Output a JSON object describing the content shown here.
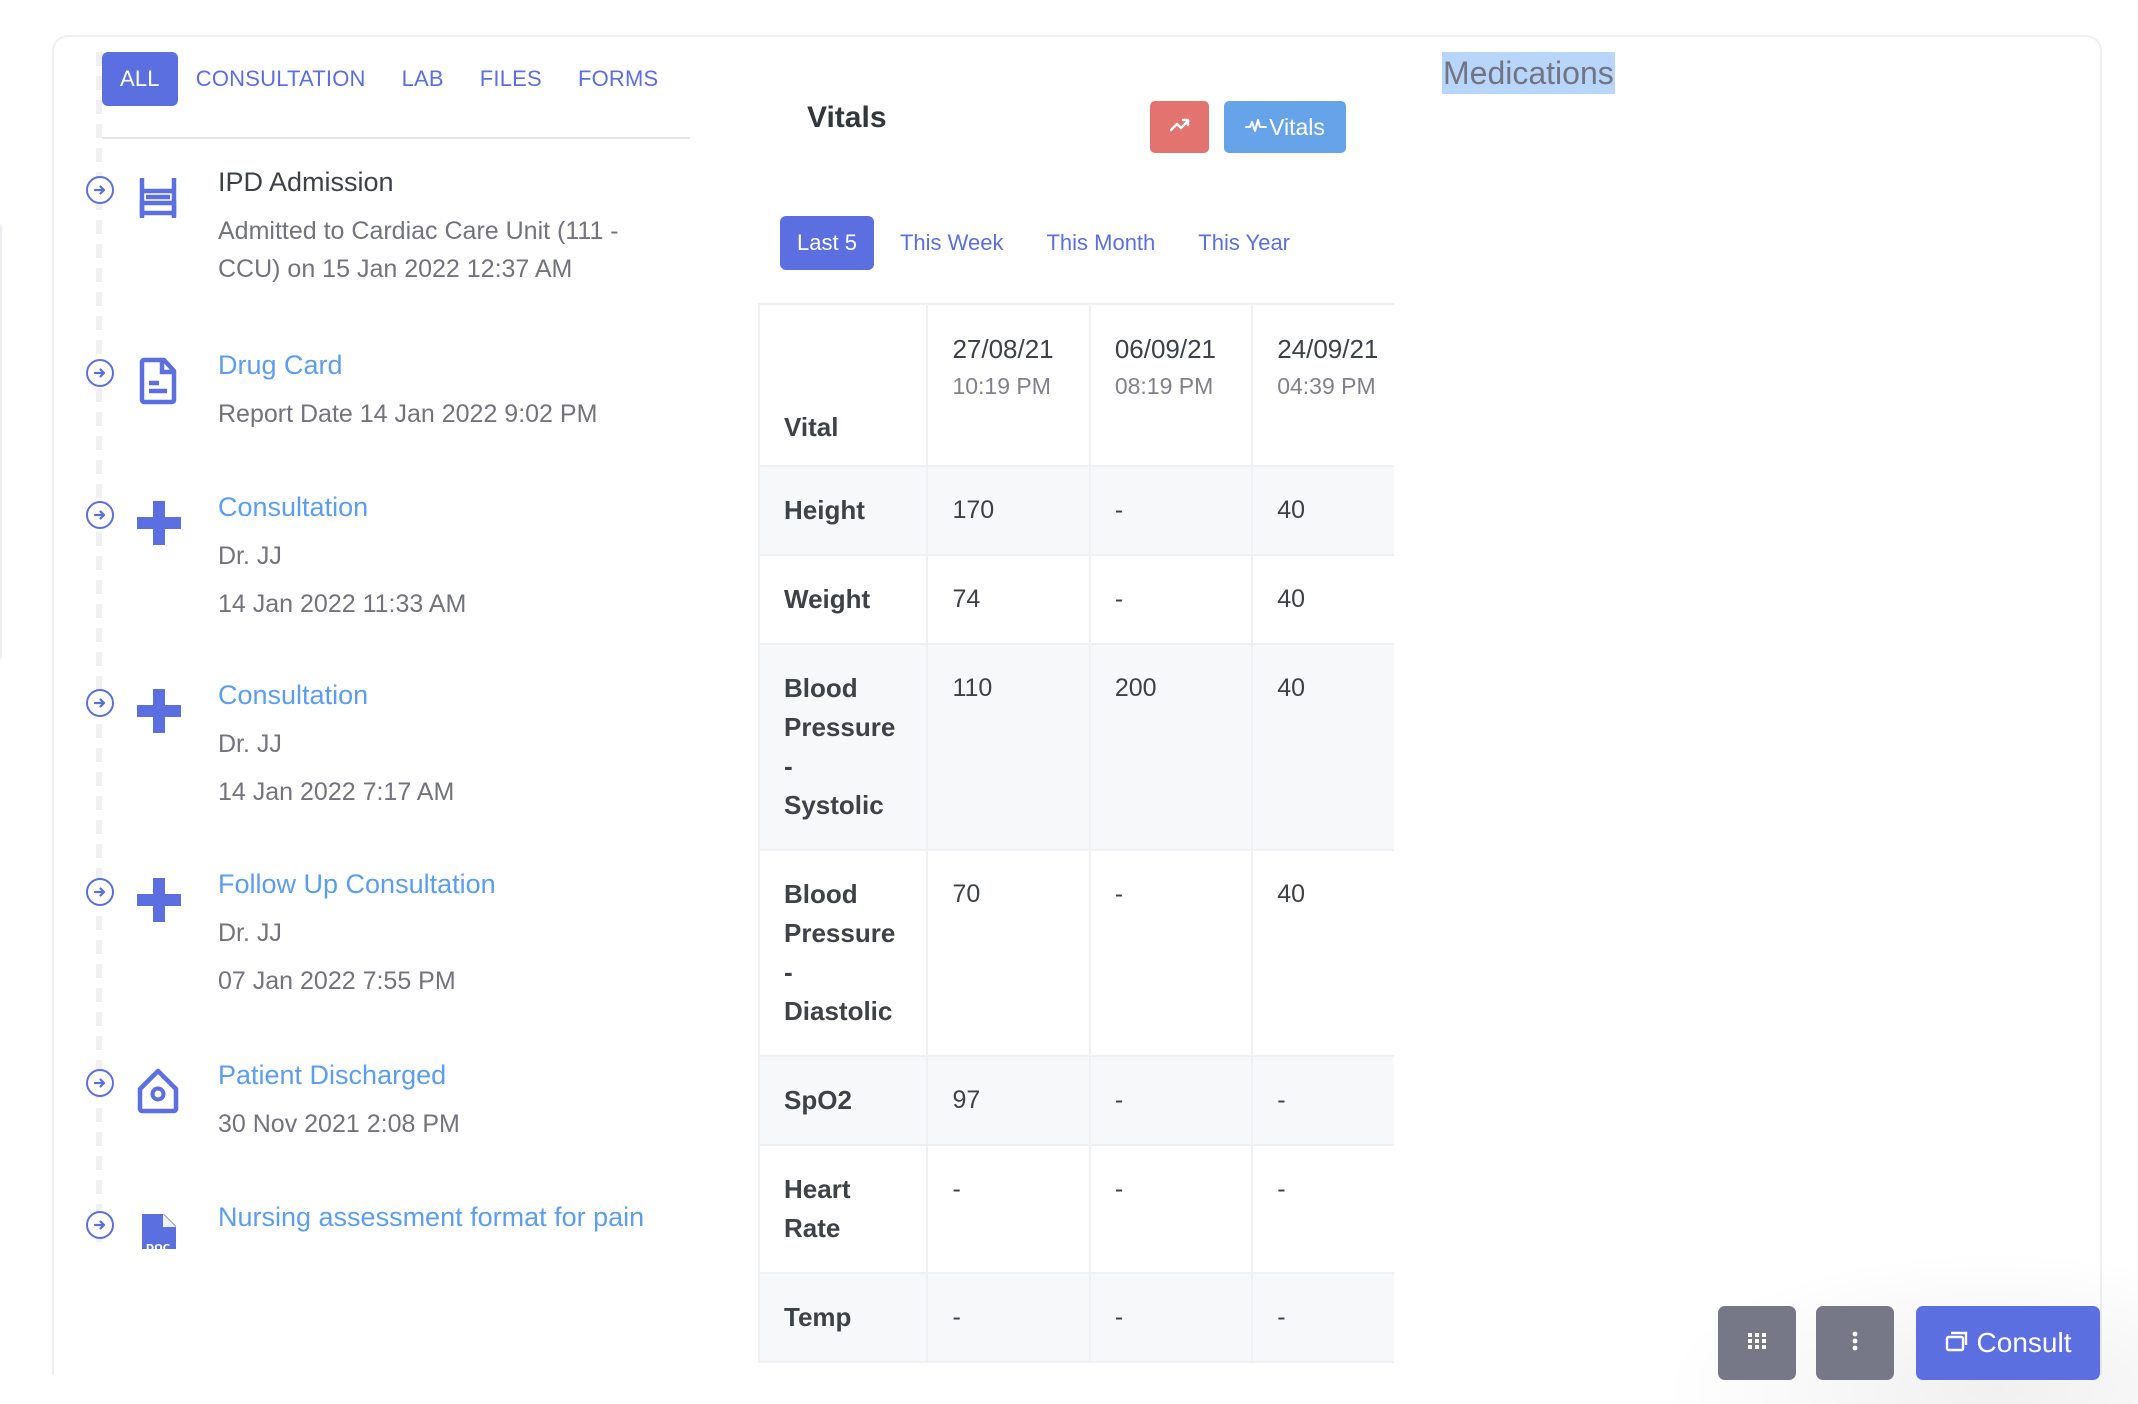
{
  "timeline": {
    "tabs": [
      {
        "label": "ALL",
        "active": true
      },
      {
        "label": "CONSULTATION",
        "active": false
      },
      {
        "label": "LAB",
        "active": false
      },
      {
        "label": "FILES",
        "active": false
      },
      {
        "label": "FORMS",
        "active": false
      }
    ],
    "entries": [
      {
        "icon": "bed-icon",
        "title": "IPD Admission",
        "title_style": "dark",
        "lines": [
          "Admitted to Cardiac Care Unit (111 -",
          "CCU) on 15 Jan 2022 12:37 AM"
        ]
      },
      {
        "icon": "document-icon",
        "title": "Drug Card",
        "title_style": "link",
        "lines": [
          "Report Date 14 Jan 2022 9:02 PM"
        ]
      },
      {
        "icon": "medical-cross-icon",
        "title": "Consultation",
        "title_style": "link",
        "lines": [
          "Dr. JJ",
          "14 Jan 2022 11:33 AM"
        ]
      },
      {
        "icon": "medical-cross-icon",
        "title": "Consultation",
        "title_style": "link",
        "lines": [
          "Dr. JJ",
          "14 Jan 2022 7:17 AM"
        ]
      },
      {
        "icon": "medical-cross-icon",
        "title": "Follow Up Consultation",
        "title_style": "link",
        "lines": [
          "Dr. JJ",
          "07 Jan 2022 7:55 PM"
        ]
      },
      {
        "icon": "home-discharge-icon",
        "title": "Patient Discharged",
        "title_style": "link",
        "lines": [
          "30 Nov 2021 2:08 PM"
        ]
      },
      {
        "icon": "doc-file-icon",
        "title": "Nursing assessment format for pain",
        "title_style": "link",
        "lines": []
      }
    ]
  },
  "vitals": {
    "title": "Vitals",
    "trend_button_icon": "trending-up-icon",
    "vitals_button": {
      "icon": "pulse-icon",
      "label": "Vitals"
    },
    "filters": [
      {
        "label": "Last 5",
        "active": true
      },
      {
        "label": "This Week",
        "active": false
      },
      {
        "label": "This Month",
        "active": false
      },
      {
        "label": "This Year",
        "active": false
      }
    ],
    "table": {
      "first_header": "Vital",
      "columns": [
        {
          "date": "27/08/21",
          "time": "10:19 PM"
        },
        {
          "date": "06/09/21",
          "time": "08:19 PM"
        },
        {
          "date": "24/09/21",
          "time": "04:39 PM"
        }
      ],
      "rows": [
        {
          "name": "Height",
          "values": [
            "170",
            "-",
            "40"
          ]
        },
        {
          "name": "Weight",
          "values": [
            "74",
            "-",
            "40"
          ]
        },
        {
          "name": "Blood Pressure - Systolic",
          "values": [
            "110",
            "200",
            "40"
          ]
        },
        {
          "name": "Blood Pressure - Diastolic",
          "values": [
            "70",
            "-",
            "40"
          ]
        },
        {
          "name": "SpO2",
          "values": [
            "97",
            "-",
            "-"
          ]
        },
        {
          "name": "Heart Rate",
          "values": [
            "-",
            "-",
            "-"
          ]
        },
        {
          "name": "Temp",
          "values": [
            "-",
            "-",
            "-"
          ]
        }
      ]
    }
  },
  "medications": {
    "title": "Medications",
    "selected": true
  },
  "actions": {
    "grid_icon": "apps-grid-icon",
    "more_icon": "more-vertical-icon",
    "consult": {
      "icon": "windows-icon",
      "label": "Consult"
    }
  },
  "colors": {
    "primary": "#5b6fe0",
    "link": "#5b9ef0",
    "trend_button": "#e2736f",
    "vitals_button": "#66a3e9",
    "secondary_button": "#767888",
    "selection": "#b8d6fb"
  }
}
